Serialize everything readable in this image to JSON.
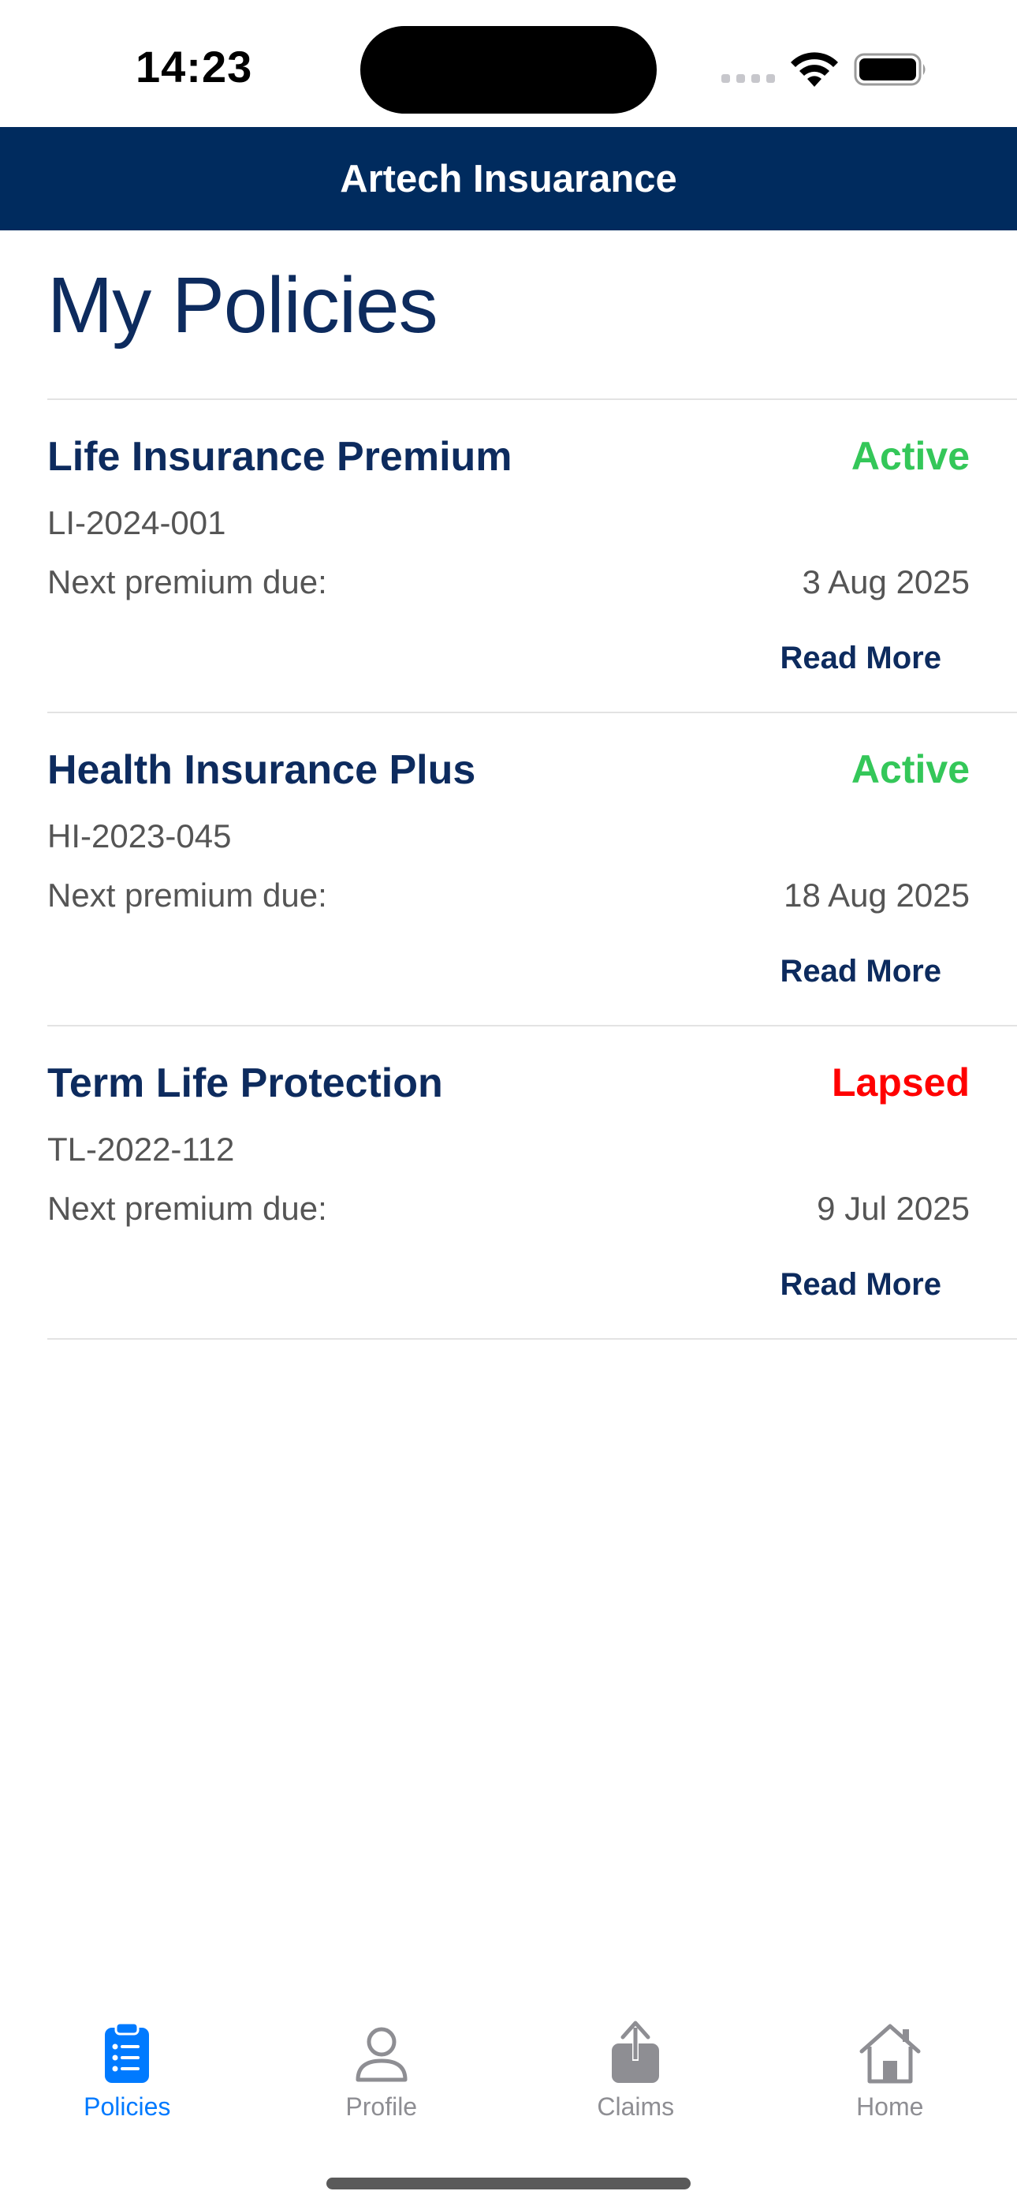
{
  "status_bar": {
    "time": "14:23"
  },
  "header": {
    "title": "Artech Insuarance"
  },
  "page": {
    "title": "My Policies"
  },
  "policies": [
    {
      "name": "Life Insurance Premium",
      "status": "Active",
      "status_color": "#34c759",
      "number": "LI-2024-001",
      "due_label": "Next premium due:",
      "due_date": "3 Aug 2025",
      "read_more": "Read More"
    },
    {
      "name": "Health Insurance Plus",
      "status": "Active",
      "status_color": "#34c759",
      "number": "HI-2023-045",
      "due_label": "Next premium due:",
      "due_date": "18 Aug 2025",
      "read_more": "Read More"
    },
    {
      "name": "Term Life Protection",
      "status": "Lapsed",
      "status_color": "#ff0000",
      "number": "TL-2022-112",
      "due_label": "Next premium due:",
      "due_date": "9 Jul 2025",
      "read_more": "Read More"
    }
  ],
  "tab_bar": {
    "items": [
      {
        "label": "Policies",
        "icon": "clipboard-list-icon",
        "active": true
      },
      {
        "label": "Profile",
        "icon": "person-icon",
        "active": false
      },
      {
        "label": "Claims",
        "icon": "share-upload-icon",
        "active": false
      },
      {
        "label": "Home",
        "icon": "house-icon",
        "active": false
      }
    ]
  },
  "colors": {
    "header_bg": "#002b5e",
    "primary_text": "#0d2b5e",
    "active_status": "#34c759",
    "lapsed_status": "#ff0000",
    "tab_active": "#007aff",
    "tab_inactive": "#8e8e93"
  }
}
